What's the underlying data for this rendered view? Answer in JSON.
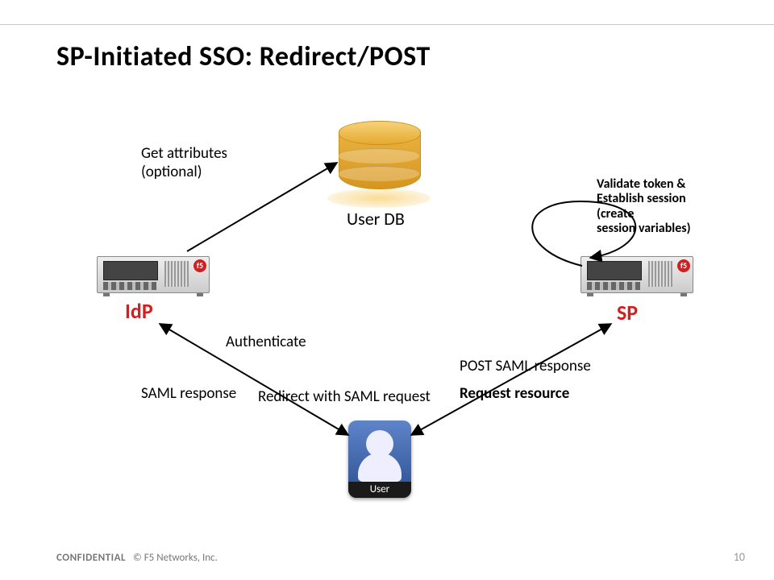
{
  "title": "SP-Initiated SSO: Redirect/POST",
  "nodes": {
    "userdb": "User DB",
    "idp": "IdP",
    "sp": "SP",
    "user": "User"
  },
  "edges": {
    "get_attrs": "Get attributes\n(optional)",
    "validate": "Validate token &\nEstablish session\n(create\nsession variables)",
    "authenticate": "Authenticate",
    "saml_response": "SAML response",
    "redirect_req": "Redirect with SAML request",
    "post_resp": "POST SAML response",
    "request_res": "Request resource"
  },
  "footer": {
    "confidential": "CONFIDENTIAL",
    "copyright": "© F5 Networks, Inc."
  },
  "pageno": "10"
}
